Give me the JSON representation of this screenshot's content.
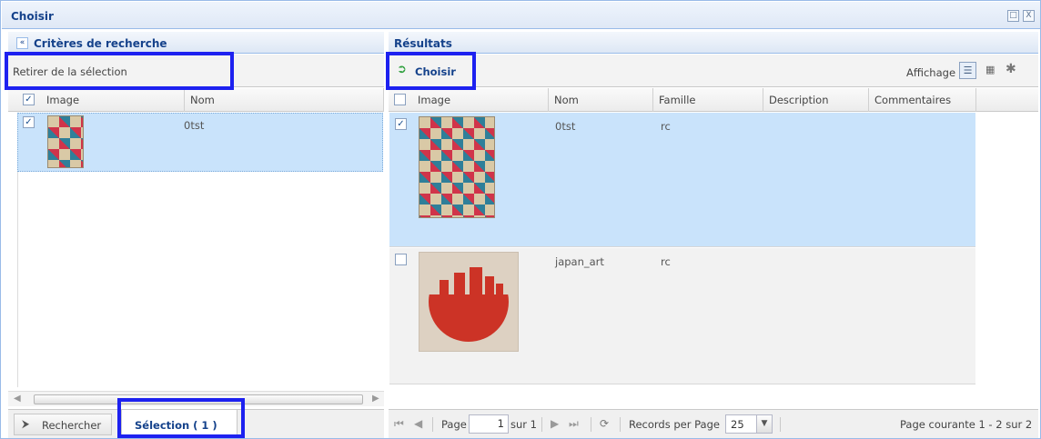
{
  "window": {
    "title": "Choisir",
    "restore_symbol": "□",
    "close_symbol": "X"
  },
  "left": {
    "header": "Critères de recherche",
    "collapse_symbol": "«",
    "toolbar_label": "Retirer de la sélection",
    "columns": [
      "Image",
      "Nom"
    ],
    "rows": [
      {
        "name": "0tst",
        "checked": true,
        "image": "argyle-pattern"
      }
    ],
    "tabs": {
      "search": "Rechercher",
      "selection": "Sélection ( 1 )"
    },
    "scroll_grip": "..."
  },
  "right": {
    "header": "Résultats",
    "choose_button": "Choisir",
    "display_label": "Affichage",
    "columns": [
      "Image",
      "Nom",
      "Famille",
      "Description",
      "Commentaires"
    ],
    "rows": [
      {
        "name": "0tst",
        "family": "rc",
        "description": "",
        "comments": "",
        "checked": true,
        "image": "argyle-pattern"
      },
      {
        "name": "japan_art",
        "family": "rc",
        "description": "",
        "comments": "",
        "checked": false,
        "image": "japan-art"
      }
    ],
    "paging": {
      "page_label": "Page",
      "page_value": "1",
      "of_label": "sur 1",
      "records_label": "Records per Page",
      "records_value": "25",
      "status": "Page courante 1 - 2 sur 2"
    }
  },
  "colors": {
    "accent": "#15428b",
    "highlight": "#1d21f0",
    "selected_row": "#c9e3fb"
  },
  "icons": [
    "collapse-icon",
    "choose-icon",
    "list-view-icon",
    "grid-view-icon",
    "gear-icon",
    "search-icon",
    "first-page-icon",
    "prev-page-icon",
    "next-page-icon",
    "last-page-icon",
    "refresh-icon",
    "dropdown-icon"
  ]
}
